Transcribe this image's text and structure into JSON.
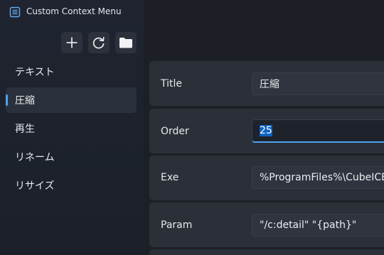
{
  "window": {
    "title": "Custom Context Menu",
    "icons": {
      "app": "list-app-icon",
      "add": "plus-icon",
      "refresh": "refresh-icon",
      "open": "folder-icon"
    }
  },
  "sidebar": {
    "items": [
      {
        "label": "テキスト",
        "selected": false
      },
      {
        "label": "圧縮",
        "selected": true
      },
      {
        "label": "再生",
        "selected": false
      },
      {
        "label": "リネーム",
        "selected": false
      },
      {
        "label": "リサイズ",
        "selected": false
      }
    ]
  },
  "form": {
    "title": {
      "label": "Title",
      "value": "圧縮"
    },
    "order": {
      "label": "Order",
      "value": "25"
    },
    "exe": {
      "label": "Exe",
      "value": "%ProgramFiles%\\CubeICE\\cub"
    },
    "param": {
      "label": "Param",
      "value": "\"/c:detail\" \"{path}\""
    }
  },
  "colors": {
    "accent": "#4aa5f5",
    "selection": "#0e62c2",
    "card": "#2a2f38",
    "nav_selected": "#2b313c"
  }
}
